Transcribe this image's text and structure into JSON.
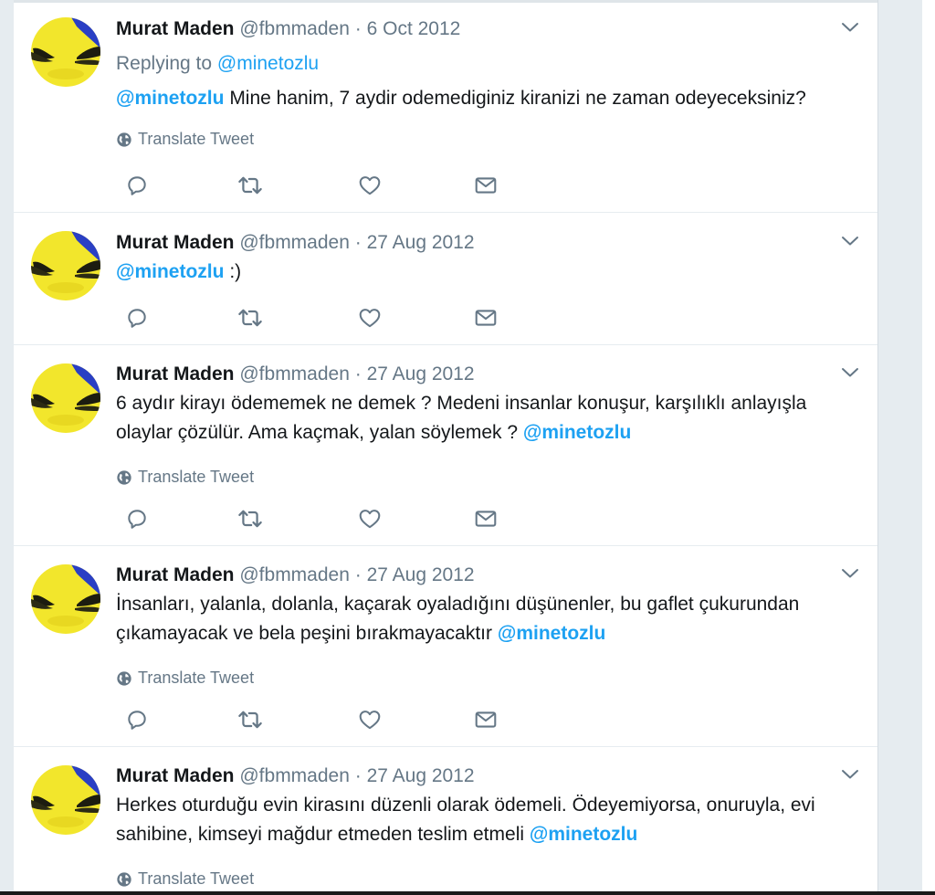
{
  "colors": {
    "link": "#1da1f2",
    "secondary_text": "#657786",
    "primary_text": "#14171a",
    "divider": "#e6ecf0"
  },
  "icons": {
    "reply": "reply-icon",
    "retweet": "retweet-icon",
    "like": "heart-icon",
    "dm": "envelope-icon",
    "caret": "chevron-down-icon",
    "globe": "globe-icon"
  },
  "tweets": [
    {
      "name": "Murat Maden",
      "handle": "@fbmmaden",
      "separator": "·",
      "date": "6 Oct 2012",
      "replying_label": "Replying to",
      "replying_to": "@minetozlu",
      "mention_lead": "@minetozlu",
      "text": " Mine hanim, 7 aydir odemediginiz kiranizi ne zaman odeyeceksiniz?",
      "translate": "Translate Tweet"
    },
    {
      "name": "Murat Maden",
      "handle": "@fbmmaden",
      "separator": "·",
      "date": "27 Aug 2012",
      "mention_lead": "@minetozlu",
      "text": " :)"
    },
    {
      "name": "Murat Maden",
      "handle": "@fbmmaden",
      "separator": "·",
      "date": "27 Aug 2012",
      "text": "6 aydır kirayı ödememek ne demek ? Medeni insanlar konuşur, karşılıklı anlayışla olaylar çözülür. Ama kaçmak, yalan söylemek ? ",
      "mention_trail": "@minetozlu",
      "translate": "Translate Tweet"
    },
    {
      "name": "Murat Maden",
      "handle": "@fbmmaden",
      "separator": "·",
      "date": "27 Aug 2012",
      "text": "İnsanları, yalanla, dolanla, kaçarak oyaladığını düşünenler, bu gaflet çukurundan çıkamayacak ve bela peşini bırakmayacaktır ",
      "mention_trail": "@minetozlu",
      "translate": "Translate Tweet"
    },
    {
      "name": "Murat Maden",
      "handle": "@fbmmaden",
      "separator": "·",
      "date": "27 Aug 2012",
      "text": "Herkes oturduğu evin kirasını düzenli olarak ödemeli. Ödeyemiyorsa, onuruyla, evi sahibine, kimseyi mağdur etmeden teslim etmeli ",
      "mention_trail": "@minetozlu",
      "translate": "Translate Tweet"
    }
  ]
}
